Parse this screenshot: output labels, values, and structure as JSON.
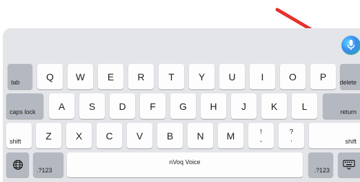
{
  "keyboard": {
    "row1": [
      "tab",
      "Q",
      "W",
      "E",
      "R",
      "T",
      "Y",
      "U",
      "I",
      "O",
      "P",
      "delete"
    ],
    "row2": [
      "caps lock",
      "A",
      "S",
      "D",
      "F",
      "G",
      "H",
      "J",
      "K",
      "L",
      "return"
    ],
    "row3": {
      "shift_left": "shift",
      "letters": [
        "Z",
        "X",
        "C",
        "V",
        "B",
        "N",
        "M"
      ],
      "exclaim_top": "!",
      "exclaim_bottom": ",",
      "question_top": "?",
      "question_bottom": ".",
      "shift_right": "shift"
    },
    "row4": {
      "globe_icon": "globe-icon",
      "numbers_left": ".?123",
      "space": "nVoq Voice",
      "numbers_right": ".?123",
      "hide_icon": "keyboard-hide-icon"
    }
  },
  "annotation": {
    "arrow_color": "#e5312b",
    "mic_icon": "microphone-icon"
  }
}
